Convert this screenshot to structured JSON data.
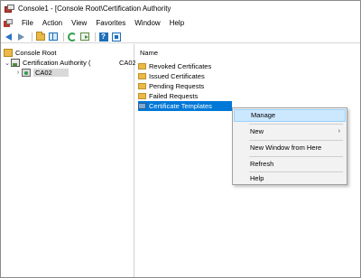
{
  "window": {
    "title": "Console1 - [Console Root\\Certification Authority"
  },
  "menubar": {
    "items": [
      "File",
      "Action",
      "View",
      "Favorites",
      "Window",
      "Help"
    ]
  },
  "toolbar": {
    "icons": [
      "back-arrow-icon",
      "forward-arrow-icon",
      "up-folder-icon",
      "show-hide-pane-icon",
      "refresh-icon",
      "export-list-icon",
      "help-icon",
      "properties-icon"
    ],
    "help_glyph": "?"
  },
  "tree": {
    "root_label": "Console Root",
    "ca_label": "Certification Authority (",
    "ca_suffix": "CA02",
    "server_label": "CA02"
  },
  "list": {
    "column_header": "Name",
    "items": [
      {
        "label": "Revoked Certificates",
        "icon": "folder-icon"
      },
      {
        "label": "Issued Certificates",
        "icon": "folder-icon"
      },
      {
        "label": "Pending Requests",
        "icon": "folder-icon"
      },
      {
        "label": "Failed Requests",
        "icon": "folder-icon"
      },
      {
        "label": "Certificate Templates",
        "icon": "certificate-templates-icon",
        "selected": true
      }
    ]
  },
  "context_menu": {
    "items": [
      {
        "label": "Manage",
        "highlighted": true
      },
      {
        "label": "New",
        "has_submenu": true,
        "submenu_glyph": "›"
      },
      {
        "label": "New Window from Here"
      },
      {
        "label": "Refresh"
      },
      {
        "label": "Help"
      }
    ]
  },
  "colors": {
    "selection": "#0078d7",
    "menu_hover": "#cce8ff"
  }
}
